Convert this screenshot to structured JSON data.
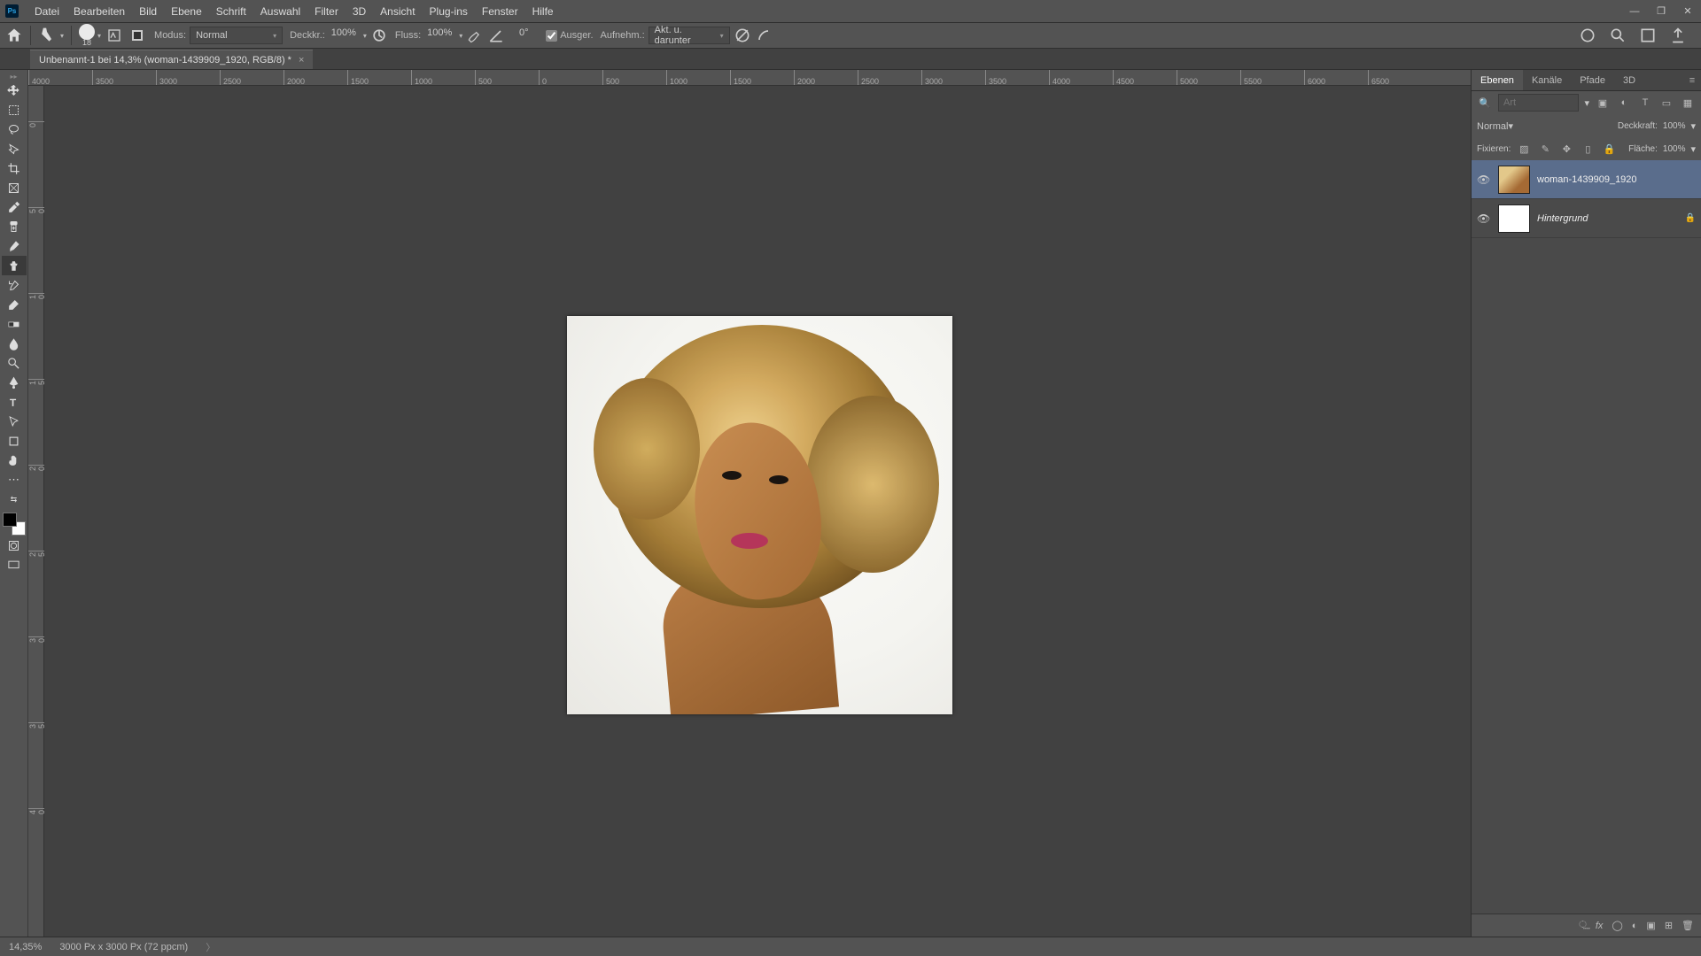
{
  "menubar": {
    "items": [
      "Datei",
      "Bearbeiten",
      "Bild",
      "Ebene",
      "Schrift",
      "Auswahl",
      "Filter",
      "3D",
      "Ansicht",
      "Plug-ins",
      "Fenster",
      "Hilfe"
    ]
  },
  "optionsbar": {
    "brush_size": "18",
    "mode_label": "Modus:",
    "mode_value": "Normal",
    "opacity_label": "Deckkr.:",
    "opacity_value": "100%",
    "flow_label": "Fluss:",
    "flow_value": "100%",
    "angle_label": "",
    "angle_value": "0°",
    "ausger_label": "Ausger.",
    "aufnehm_label": "Aufnehm.:",
    "sample_value": "Akt. u. darunter"
  },
  "document": {
    "tab_title": "Unbenannt-1 bei 14,3% (woman-1439909_1920, RGB/8) *"
  },
  "ruler_h": [
    "4000",
    "3500",
    "3000",
    "2500",
    "2000",
    "1500",
    "1000",
    "500",
    "0",
    "500",
    "1000",
    "1500",
    "2000",
    "2500",
    "3000",
    "3500",
    "4000",
    "4500",
    "5000",
    "5500",
    "6000",
    "6500"
  ],
  "ruler_v": [
    "0",
    "500",
    "1000",
    "1500",
    "2000",
    "2500",
    "3000",
    "3500",
    "4000"
  ],
  "panels": {
    "tabs": [
      "Ebenen",
      "Kanäle",
      "Pfade",
      "3D"
    ],
    "filter_placeholder": "Art",
    "blend_mode": "Normal",
    "opacity_label": "Deckkraft:",
    "opacity_value": "100%",
    "lock_label": "Fixieren:",
    "fill_label": "Fläche:",
    "fill_value": "100%",
    "layers": [
      {
        "name": "woman-1439909_1920",
        "locked": false,
        "selected": true,
        "thumb": "img"
      },
      {
        "name": "Hintergrund",
        "locked": true,
        "selected": false,
        "thumb": "white",
        "italic": true
      }
    ]
  },
  "statusbar": {
    "zoom": "14,35%",
    "info": "3000 Px x 3000 Px (72 ppcm)"
  }
}
